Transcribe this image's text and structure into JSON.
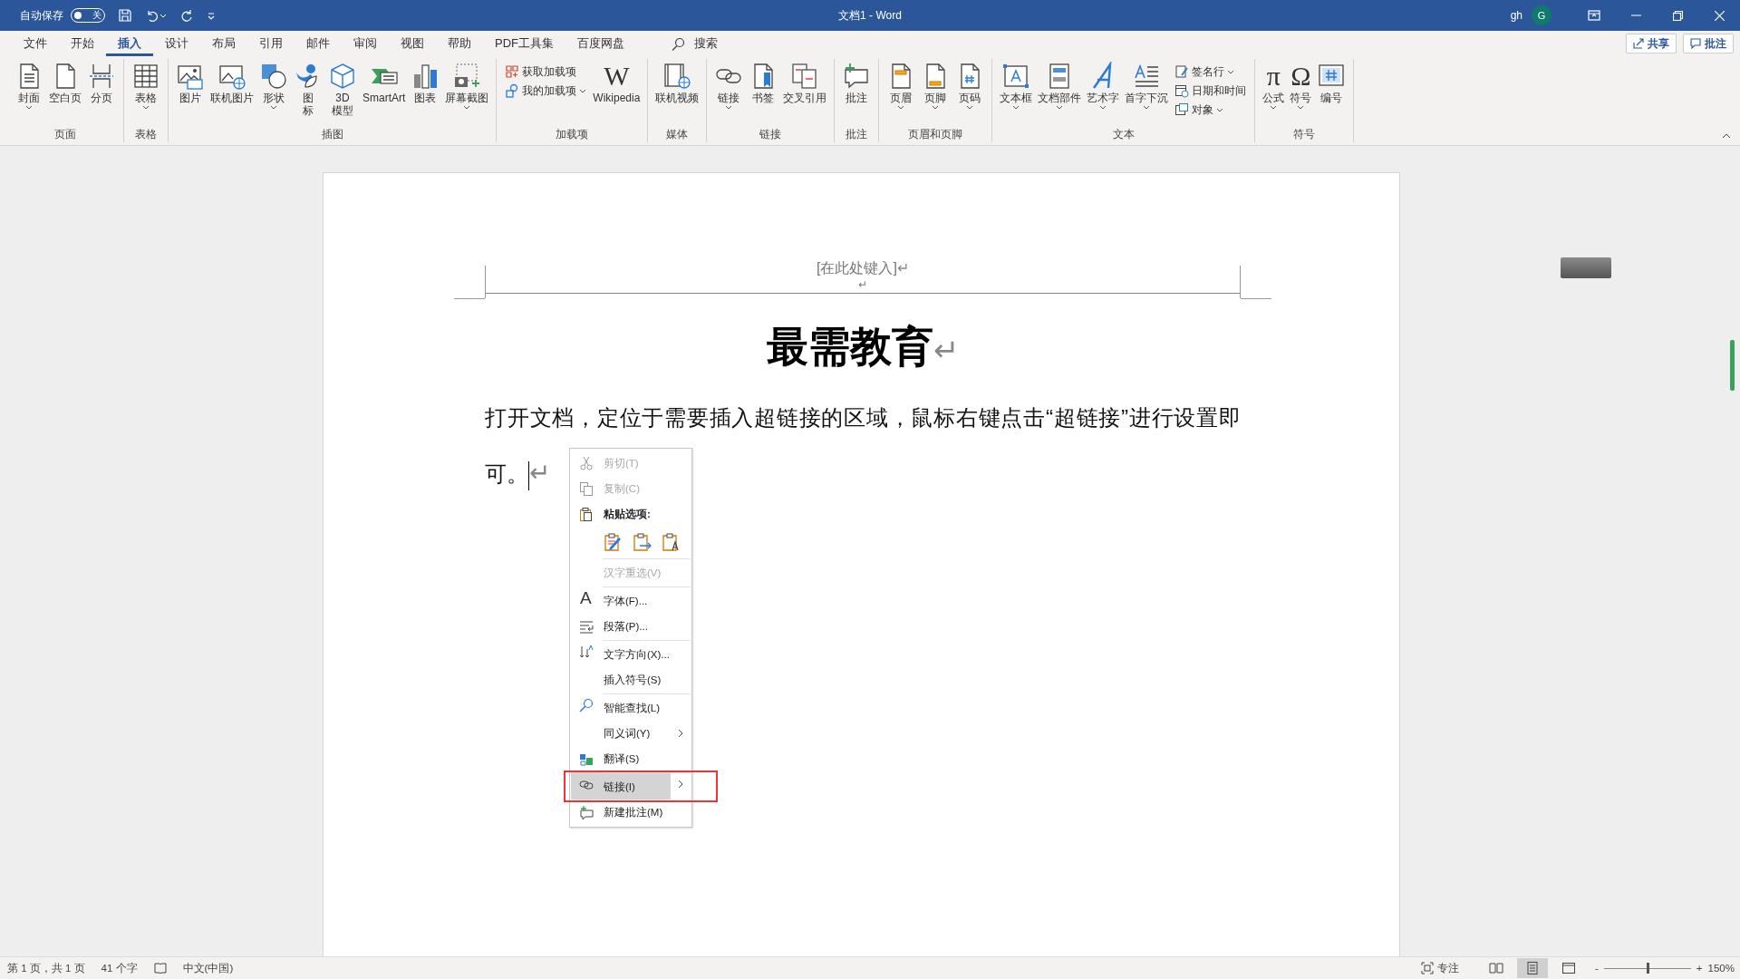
{
  "title_bar": {
    "autosave": {
      "label": "自动保存",
      "on": false,
      "state_text": "关"
    },
    "document_title": "文档1  -  Word",
    "user": "gh",
    "avatar_letter": "G"
  },
  "menu_tabs": [
    {
      "label": "文件",
      "selected": false
    },
    {
      "label": "开始",
      "selected": false
    },
    {
      "label": "插入",
      "selected": true
    },
    {
      "label": "设计",
      "selected": false
    },
    {
      "label": "布局",
      "selected": false
    },
    {
      "label": "引用",
      "selected": false
    },
    {
      "label": "邮件",
      "selected": false
    },
    {
      "label": "审阅",
      "selected": false
    },
    {
      "label": "视图",
      "selected": false
    },
    {
      "label": "帮助",
      "selected": false
    },
    {
      "label": "PDF工具集",
      "selected": false
    },
    {
      "label": "百度网盘",
      "selected": false
    }
  ],
  "search": {
    "label": "搜索"
  },
  "share_button": "共享",
  "comments_button": "批注",
  "ribbon": {
    "groups": [
      {
        "label": "页面",
        "items": [
          {
            "label": "封面",
            "kind": "large",
            "caret": true
          },
          {
            "label": "空白页",
            "kind": "large",
            "caret": false
          },
          {
            "label": "分页",
            "kind": "large",
            "caret": false
          }
        ]
      },
      {
        "label": "表格",
        "items": [
          {
            "label": "表格",
            "kind": "large",
            "caret": true
          }
        ]
      },
      {
        "label": "插图",
        "items": [
          {
            "label": "图片",
            "kind": "large",
            "caret": false
          },
          {
            "label": "联机图片",
            "kind": "large",
            "caret": false
          },
          {
            "label": "形状",
            "kind": "large",
            "caret": true
          },
          {
            "label": "图标",
            "kind": "stacked",
            "caret": false
          },
          {
            "label": "3D模型",
            "kind": "narrow",
            "caret": false
          },
          {
            "label": "SmartArt",
            "kind": "large",
            "caret": false
          },
          {
            "label": "图表",
            "kind": "large",
            "caret": false
          },
          {
            "label": "屏幕截图",
            "kind": "large",
            "caret": true
          }
        ]
      },
      {
        "label": "加载项",
        "items": [
          {
            "label": "获取加载项",
            "kind": "small",
            "caret": false
          },
          {
            "label": "我的加载项",
            "kind": "small",
            "caret": true
          },
          {
            "label": "Wikipedia",
            "kind": "large",
            "caret": false,
            "glyph": "W"
          }
        ]
      },
      {
        "label": "媒体",
        "items": [
          {
            "label": "联机视频",
            "kind": "large",
            "caret": false
          }
        ]
      },
      {
        "label": "链接",
        "items": [
          {
            "label": "链接",
            "kind": "large",
            "caret": true
          },
          {
            "label": "书签",
            "kind": "large",
            "caret": false
          },
          {
            "label": "交叉引用",
            "kind": "large",
            "caret": false
          }
        ]
      },
      {
        "label": "批注",
        "items": [
          {
            "label": "批注",
            "kind": "large",
            "caret": false
          }
        ]
      },
      {
        "label": "页眉和页脚",
        "items": [
          {
            "label": "页眉",
            "kind": "large",
            "caret": true
          },
          {
            "label": "页脚",
            "kind": "large",
            "caret": true
          },
          {
            "label": "页码",
            "kind": "large",
            "caret": true
          }
        ]
      },
      {
        "label": "文本",
        "items": [
          {
            "label": "文本框",
            "kind": "large",
            "caret": true
          },
          {
            "label": "文档部件",
            "kind": "large",
            "caret": true
          },
          {
            "label": "艺术字",
            "kind": "large",
            "caret": true
          },
          {
            "label": "首字下沉",
            "kind": "large",
            "caret": true
          },
          {
            "label": "签名行",
            "kind": "small",
            "caret": true
          },
          {
            "label": "日期和时间",
            "kind": "small",
            "caret": false
          },
          {
            "label": "对象",
            "kind": "small",
            "caret": true
          }
        ]
      },
      {
        "label": "符号",
        "items": [
          {
            "label": "公式",
            "kind": "large",
            "caret": true,
            "glyph": "π"
          },
          {
            "label": "符号",
            "kind": "large",
            "caret": true,
            "glyph": "Ω"
          },
          {
            "label": "编号",
            "kind": "large",
            "caret": false
          }
        ]
      }
    ]
  },
  "document": {
    "header": {
      "prompt_text": "[在此处键入]",
      "mark": "↵",
      "empty_line_mark": "↵"
    },
    "heading": {
      "text": "最需教育",
      "mark": "↵"
    },
    "body": {
      "text": "打开文档，定位于需要插入超链接的区域，鼠标右键点击“超链接”进行设置即可。",
      "mark": "↵"
    }
  },
  "context_menu": {
    "items": [
      {
        "kind": "item",
        "label": "剪切(T)",
        "disabled": true,
        "selected": false,
        "outlined": false,
        "submenu": false,
        "separator_before": false
      },
      {
        "kind": "item",
        "label": "复制(C)",
        "disabled": true,
        "selected": false,
        "outlined": false,
        "submenu": false,
        "separator_before": false
      },
      {
        "kind": "header",
        "label": "粘贴选项:",
        "disabled": false,
        "selected": false,
        "outlined": false,
        "submenu": false,
        "separator_before": false
      },
      {
        "kind": "paste_options",
        "separator_before": false
      },
      {
        "kind": "item",
        "label": "汉字重选(V)",
        "disabled": true,
        "selected": false,
        "outlined": false,
        "submenu": false,
        "separator_before": true
      },
      {
        "kind": "item",
        "label": "字体(F)...",
        "glyph": "A",
        "disabled": false,
        "selected": false,
        "outlined": false,
        "submenu": false,
        "separator_before": true
      },
      {
        "kind": "item",
        "label": "段落(P)...",
        "disabled": false,
        "selected": false,
        "outlined": false,
        "submenu": false,
        "separator_before": false
      },
      {
        "kind": "item",
        "label": "文字方向(X)...",
        "disabled": false,
        "selected": false,
        "outlined": false,
        "submenu": false,
        "separator_before": true
      },
      {
        "kind": "item",
        "label": "插入符号(S)",
        "disabled": false,
        "selected": false,
        "outlined": false,
        "submenu": false,
        "separator_before": false
      },
      {
        "kind": "item",
        "label": "智能查找(L)",
        "disabled": false,
        "selected": false,
        "outlined": false,
        "submenu": false,
        "separator_before": true
      },
      {
        "kind": "item",
        "label": "同义词(Y)",
        "disabled": false,
        "selected": false,
        "outlined": false,
        "submenu": true,
        "separator_before": false
      },
      {
        "kind": "item",
        "label": "翻译(S)",
        "disabled": false,
        "selected": false,
        "outlined": false,
        "submenu": false,
        "separator_before": false
      },
      {
        "kind": "item",
        "label": "链接(I)",
        "disabled": false,
        "selected": true,
        "outlined": true,
        "submenu": true,
        "separator_before": true
      },
      {
        "kind": "item",
        "label": "新建批注(M)",
        "disabled": false,
        "selected": false,
        "outlined": false,
        "submenu": false,
        "separator_before": false
      }
    ]
  },
  "status_bar": {
    "page": "第 1 页，共 1 页",
    "words": "41 个字",
    "language": "中文(中国)",
    "focus": "专注",
    "views": [
      {
        "selected": false
      },
      {
        "selected": true
      },
      {
        "selected": false
      }
    ],
    "zoom": {
      "minus": "-",
      "plus": "+",
      "level": 0.5,
      "reading": "150%"
    }
  }
}
